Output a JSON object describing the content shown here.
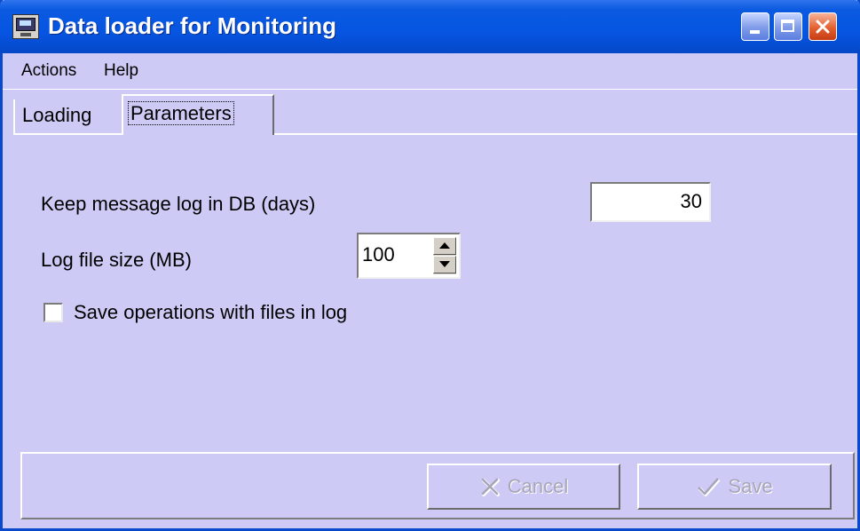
{
  "window": {
    "title": "Data loader for Monitoring",
    "icon": "monitor-app-icon",
    "controls": [
      "minimize-icon",
      "maximize-icon",
      "close-icon"
    ],
    "colors": {
      "titlebar": "#0655e2",
      "background": "#cdcbf5"
    }
  },
  "menu": {
    "items": [
      {
        "label": "Actions"
      },
      {
        "label": "Help"
      }
    ]
  },
  "tabs": [
    {
      "label": "Loading",
      "active": false
    },
    {
      "label": "Parameters",
      "active": true
    }
  ],
  "params": {
    "keep_log_label": "Keep message log in DB (days)",
    "keep_log_value": "30",
    "log_size_label": "Log file size (MB)",
    "log_size_value": "100",
    "save_ops_label": "Save operations with files in log",
    "save_ops_checked": false
  },
  "buttons": {
    "cancel_label": "Cancel",
    "cancel_icon": "cancel-x-icon",
    "save_label": "Save",
    "save_icon": "save-check-icon",
    "disabled": true
  }
}
